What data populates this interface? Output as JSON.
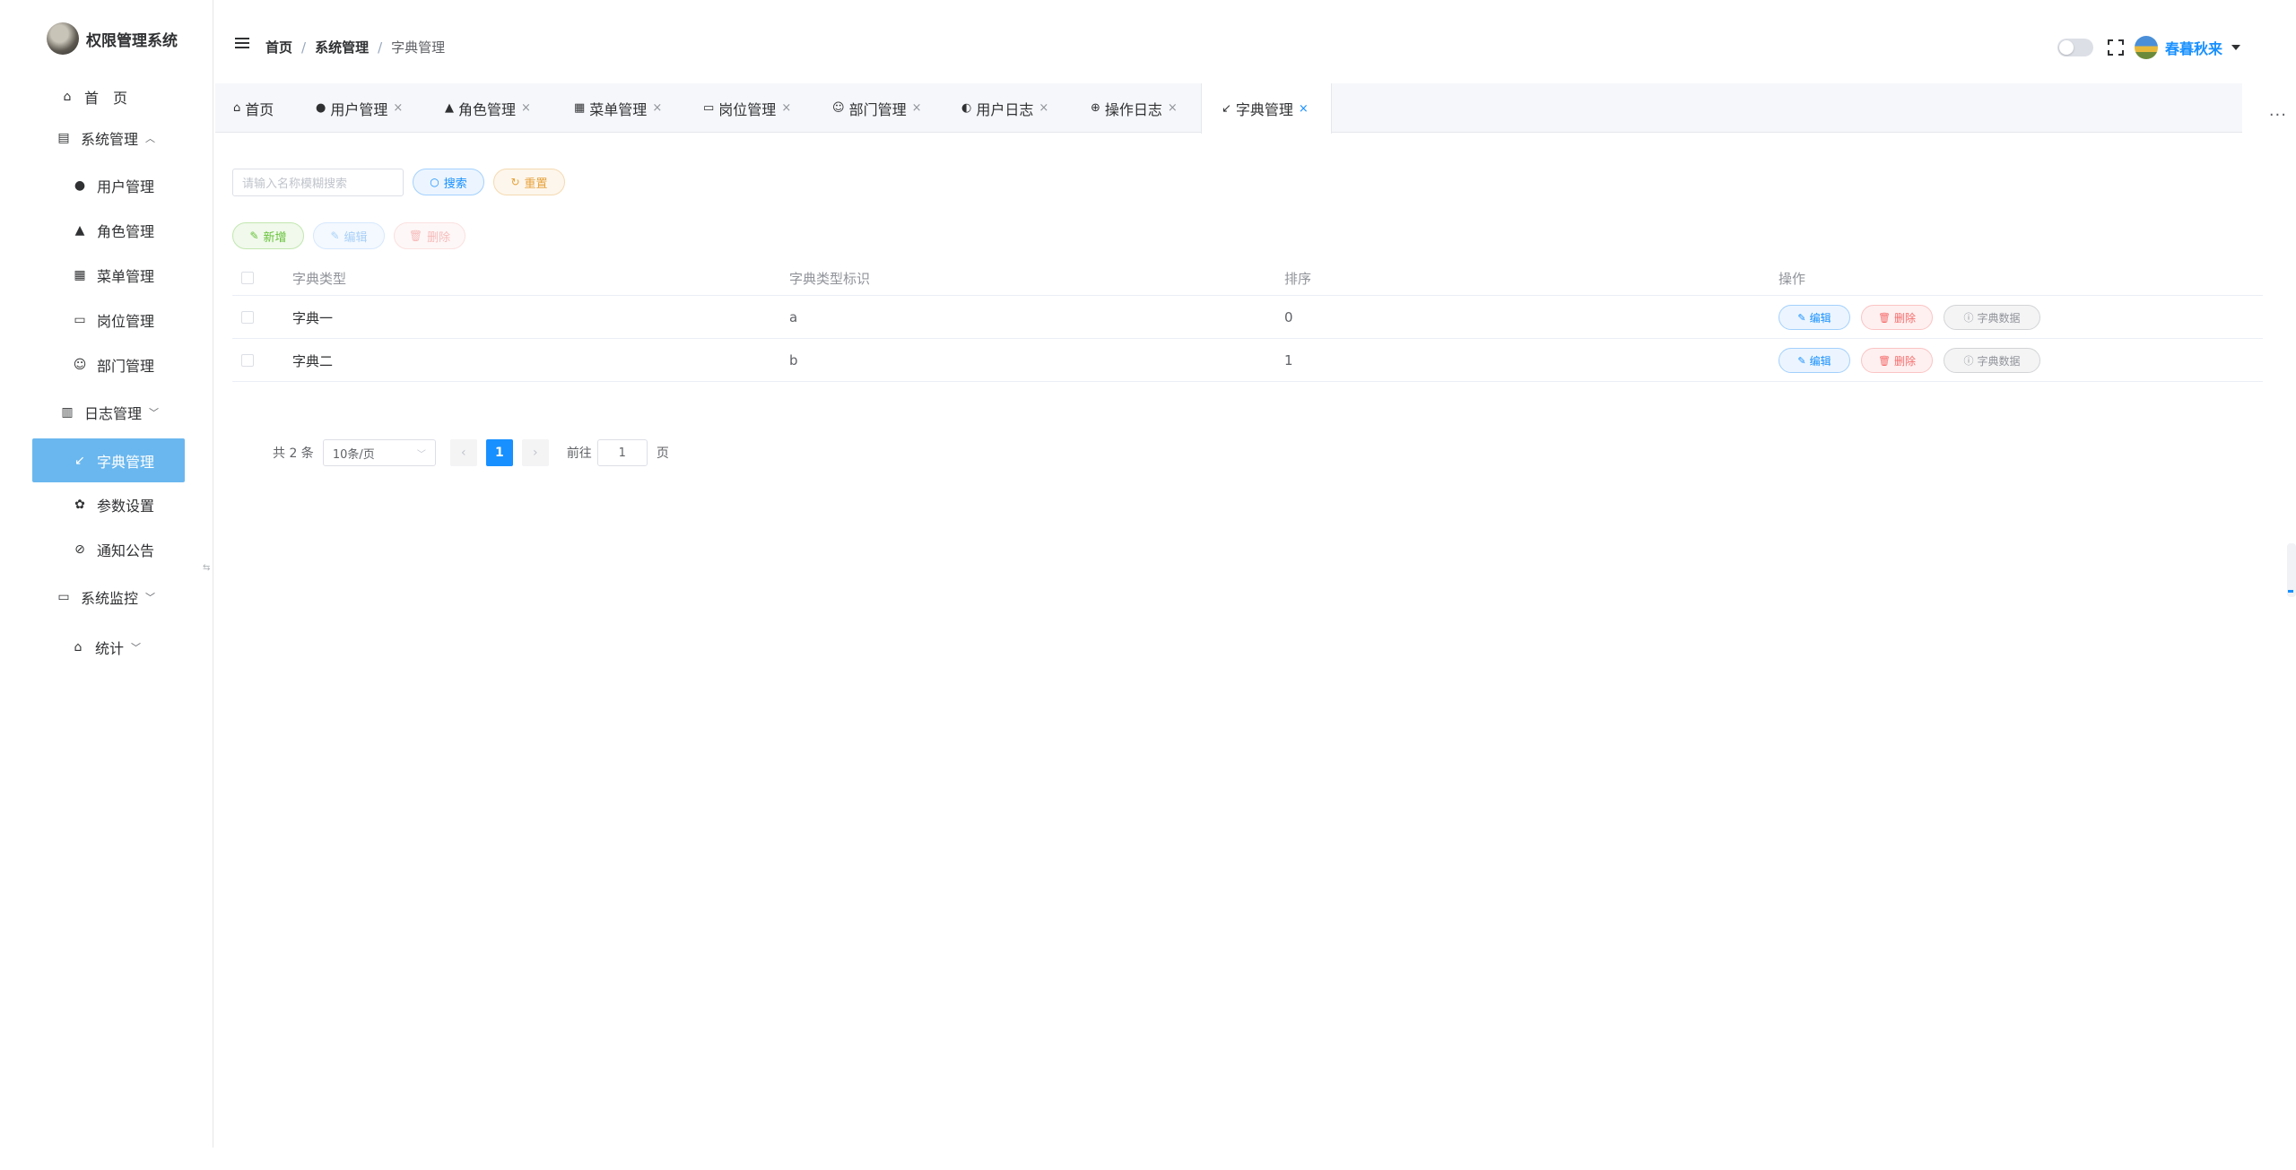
{
  "app": {
    "title": "权限管理系统"
  },
  "sidebar": {
    "items": [
      {
        "label": "首　页",
        "icon": "home-icon"
      },
      {
        "label": "系统管理",
        "icon": "system-icon",
        "expanded": true
      },
      {
        "label": "用户管理",
        "icon": "user-icon"
      },
      {
        "label": "角色管理",
        "icon": "role-icon"
      },
      {
        "label": "菜单管理",
        "icon": "menu-grid-icon"
      },
      {
        "label": "岗位管理",
        "icon": "post-icon"
      },
      {
        "label": "部门管理",
        "icon": "dept-icon"
      },
      {
        "label": "日志管理",
        "icon": "log-calendar-icon",
        "expanded": false
      },
      {
        "label": "字典管理",
        "icon": "dict-arrow-icon",
        "active": true
      },
      {
        "label": "参数设置",
        "icon": "settings-icon"
      },
      {
        "label": "通知公告",
        "icon": "notice-icon"
      },
      {
        "label": "系统监控",
        "icon": "monitor-icon",
        "expanded": false
      },
      {
        "label": "统计",
        "icon": "stats-icon",
        "expanded": false
      }
    ],
    "active_color": "#6ab7ef"
  },
  "header": {
    "breadcrumb": [
      "首页",
      "系统管理",
      "字典管理"
    ],
    "username": "春暮秋来"
  },
  "tabs": [
    {
      "label": "首页"
    },
    {
      "label": "用户管理"
    },
    {
      "label": "角色管理"
    },
    {
      "label": "菜单管理"
    },
    {
      "label": "岗位管理"
    },
    {
      "label": "部门管理"
    },
    {
      "label": "用户日志"
    },
    {
      "label": "操作日志"
    },
    {
      "label": "字典管理",
      "active": true
    }
  ],
  "search": {
    "placeholder": "请输入名称模糊搜索",
    "search_label": "搜索",
    "reset_label": "重置"
  },
  "toolbar": {
    "add_label": "新增",
    "edit_label": "编辑",
    "delete_label": "删除"
  },
  "table": {
    "columns": [
      "字典类型",
      "字典类型标识",
      "排序",
      "操作"
    ],
    "rows": [
      {
        "type": "字典一",
        "key": "a",
        "sort": "0"
      },
      {
        "type": "字典二",
        "key": "b",
        "sort": "1"
      }
    ],
    "actions": {
      "edit": "编辑",
      "delete": "删除",
      "data": "字典数据"
    }
  },
  "pagination": {
    "total": "共 2 条",
    "page_size": "10条/页",
    "current": "1",
    "goto_label": "前往",
    "goto_value": "1",
    "page_suffix": "页"
  },
  "colors": {
    "primary": "#1890ff",
    "success": "#67c23a",
    "warning": "#e6a23c",
    "danger": "#f56c6c",
    "info": "#909399"
  }
}
